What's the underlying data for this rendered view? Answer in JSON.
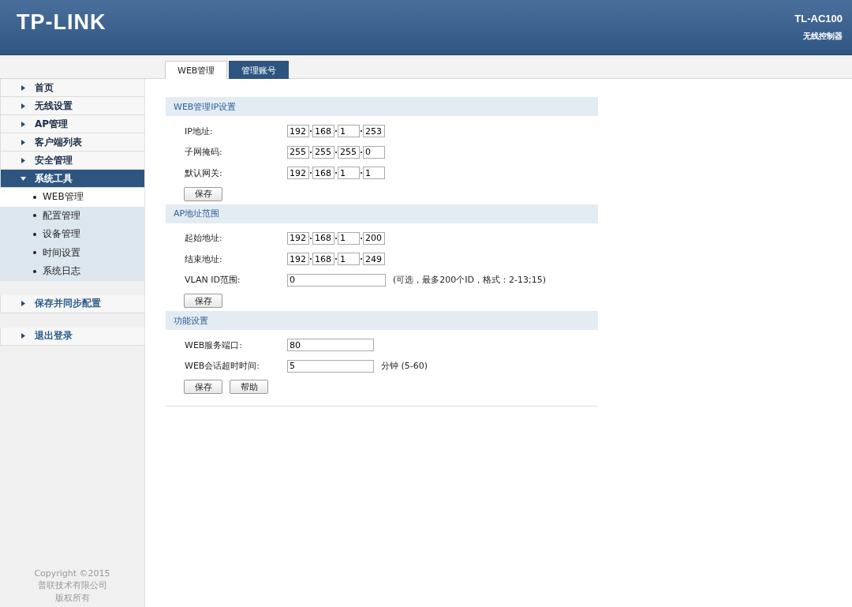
{
  "header": {
    "logo": "TP-LINK",
    "model": "TL-AC100",
    "subtitle": "无线控制器"
  },
  "tabs": [
    {
      "label": "WEB管理",
      "selected": true
    },
    {
      "label": "管理账号",
      "selected": false
    }
  ],
  "sidebar": {
    "groups": [
      {
        "items": [
          {
            "label": "首页",
            "expanded": false,
            "selected": false
          },
          {
            "label": "无线设置",
            "expanded": false,
            "selected": false
          },
          {
            "label": "AP管理",
            "expanded": false,
            "selected": false
          },
          {
            "label": "客户端列表",
            "expanded": false,
            "selected": false
          },
          {
            "label": "安全管理",
            "expanded": false,
            "selected": false
          },
          {
            "label": "系统工具",
            "expanded": true,
            "selected": true,
            "children": [
              {
                "label": "WEB管理",
                "selected": true
              },
              {
                "label": "配置管理",
                "selected": false
              },
              {
                "label": "设备管理",
                "selected": false
              },
              {
                "label": "时间设置",
                "selected": false
              },
              {
                "label": "系统日志",
                "selected": false
              }
            ]
          }
        ]
      },
      {
        "items": [
          {
            "label": "保存并同步配置",
            "kind": "action",
            "expanded": false,
            "selected": false
          }
        ]
      },
      {
        "items": [
          {
            "label": "退出登录",
            "kind": "action",
            "expanded": false,
            "selected": false
          }
        ]
      }
    ],
    "footer": [
      "Copyright ©2015",
      "普联技术有限公司",
      "版权所有"
    ]
  },
  "sections": [
    {
      "title": "WEB管理IP设置",
      "fields": [
        {
          "kind": "ip",
          "label": "IP地址:",
          "octets": [
            "192",
            "168",
            "1",
            "253"
          ]
        },
        {
          "kind": "ip",
          "label": "子网掩码:",
          "octets": [
            "255",
            "255",
            "255",
            "0"
          ]
        },
        {
          "kind": "ip",
          "label": "默认网关:",
          "octets": [
            "192",
            "168",
            "1",
            "1"
          ]
        }
      ],
      "buttons": [
        "保存"
      ]
    },
    {
      "title": "AP地址范围",
      "fields": [
        {
          "kind": "ip",
          "label": "起始地址:",
          "octets": [
            "192",
            "168",
            "1",
            "200"
          ]
        },
        {
          "kind": "ip",
          "label": "结束地址:",
          "octets": [
            "192",
            "168",
            "1",
            "249"
          ]
        },
        {
          "kind": "longtext",
          "label": "VLAN ID范围:",
          "value": "0",
          "hint": "(可选，最多200个ID，格式：2-13;15)"
        }
      ],
      "buttons": [
        "保存"
      ]
    },
    {
      "title": "功能设置",
      "fields": [
        {
          "kind": "text",
          "label": "WEB服务端口:",
          "value": "80"
        },
        {
          "kind": "text",
          "label": "WEB会话超时时间:",
          "value": "5",
          "hint": "分钟 (5-60)"
        }
      ],
      "buttons": [
        "保存",
        "帮助"
      ]
    }
  ]
}
